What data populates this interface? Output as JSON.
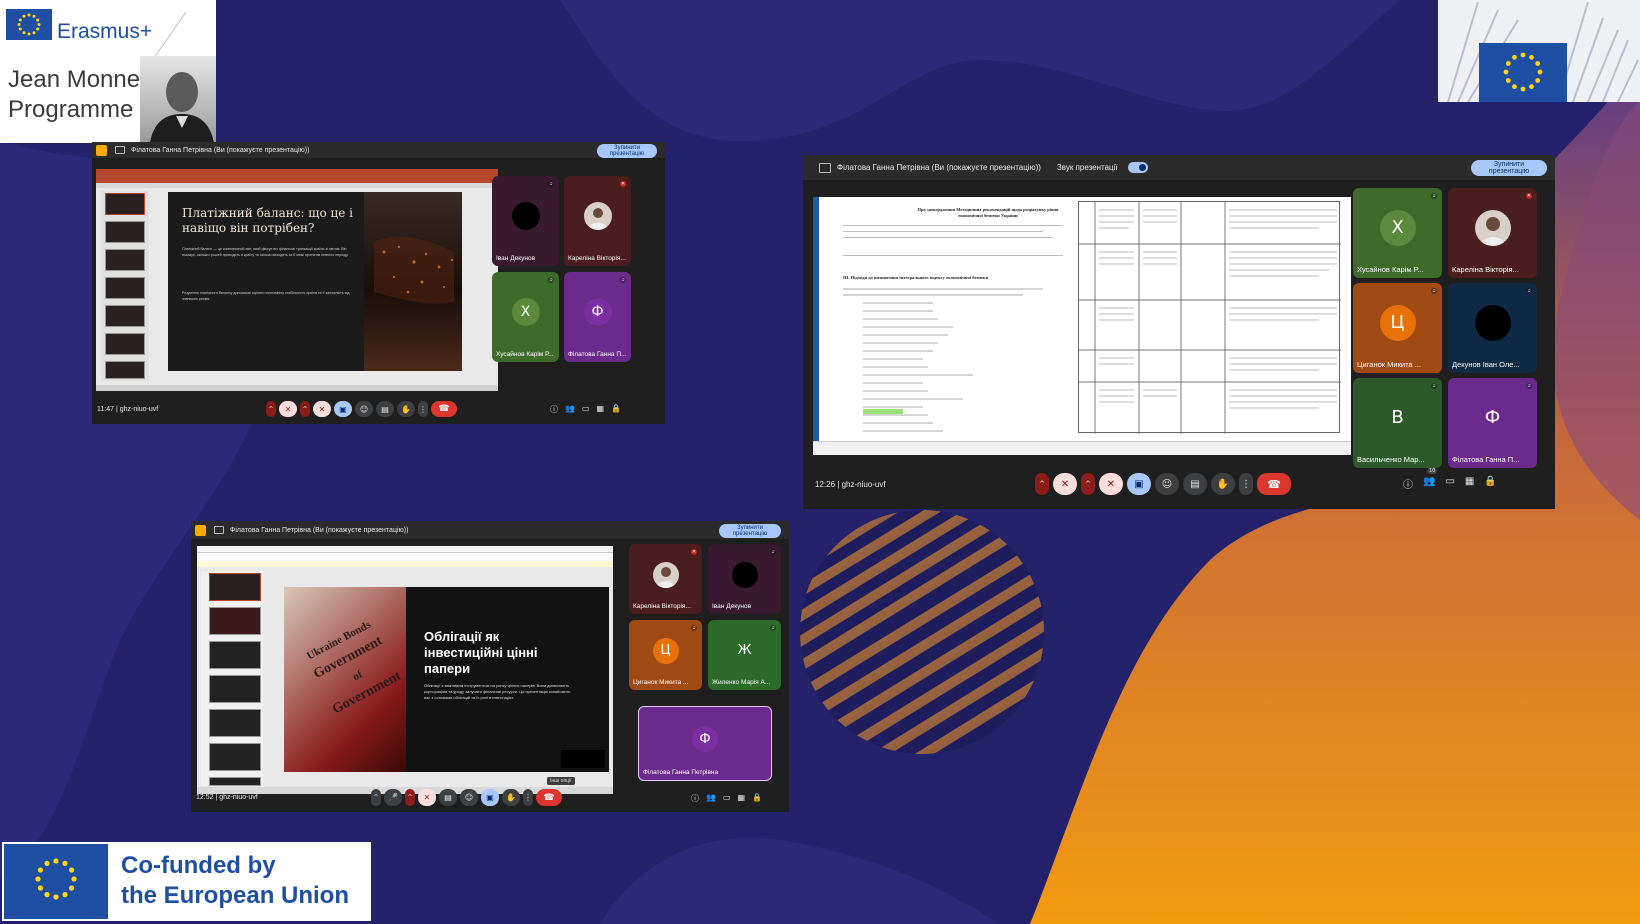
{
  "logos": {
    "erasmus": "Erasmus+",
    "jean_monnet": [
      "Jean Monnet",
      "Programme"
    ],
    "cofund": [
      "Co-funded by",
      "the European Union"
    ]
  },
  "screens": [
    {
      "presenter_label": "Філатова Ганна Петрівна (Ви (покажуєте презентацію))",
      "stop_label": "Зупинити презентацію",
      "time": "11:47",
      "meeting_code": "ghz-niuo-uvf",
      "slide": {
        "title": "Платіжний баланс: що це і навіщо він потрібен?",
        "body": "Платіжний баланс — це комплексний звіт, який фіксує всі фінансові транзакції країни зі світом. Він показує, скільки грошей приходить в країну та скільки виходить за її межі протягом певного періоду.",
        "body2": "Розуміння платіжного балансу допомагає оцінити економічну стабільність країни та її залежність від зовнішніх ринків."
      },
      "participants": [
        {
          "name": "Іван Декунов",
          "initial": "",
          "color": "#3a1a30",
          "avatar": "black"
        },
        {
          "name": "Кареліна Вікторія...",
          "initial": "",
          "color": "#4a1e1e",
          "avatar": "photo"
        },
        {
          "name": "Хусайнов Карім Р...",
          "initial": "Х",
          "color": "#3e6b2a",
          "avatar": "#5b8a3c"
        },
        {
          "name": "Філатова Ганна П...",
          "initial": "Ф",
          "color": "#6b2a8c",
          "avatar": "#7b2fa3"
        }
      ]
    },
    {
      "presenter_label": "Філатова Ганна Петрівна (Ви (покажуєте презентацію))",
      "sound_label": "Звук презентації",
      "stop_label": "Зупинити презентацію",
      "time": "12:26",
      "meeting_code": "ghz-niuo-uvf",
      "doc": {
        "title": "Про затвердження Методичних рекомендацій щодо розрахунку рівня економічної безпеки України",
        "section": "ІІІ. Підходи до визначення інтегрального індексу економічної безпеки"
      },
      "participants": [
        {
          "name": "Хусайнов Карім Р...",
          "initial": "Х",
          "color": "#3e6b2a",
          "avatar": "#5b8a3c"
        },
        {
          "name": "Кареліна Вікторія...",
          "initial": "",
          "color": "#4a1e1e",
          "avatar": "photo"
        },
        {
          "name": "Циганок Микита ...",
          "initial": "Ц",
          "color": "#a04a14",
          "avatar": "#e8710a"
        },
        {
          "name": "Декунов Іван Оле...",
          "initial": "",
          "color": "#0e2a44",
          "avatar": "black"
        },
        {
          "name": "Васильченко Мар...",
          "initial": "В",
          "color": "#2d5a2a",
          "avatar": "#2d5a2a"
        },
        {
          "name": "Філатова Ганна П...",
          "initial": "Ф",
          "color": "#6b2a8c",
          "avatar": "#6b2a8c"
        }
      ],
      "participant_count": "10"
    },
    {
      "presenter_label": "Філатова Ганна Петрівна (Ви (покажуєте презентацію))",
      "stop_label": "Зупинити презентацію",
      "time": "12:52",
      "meeting_code": "ghz-niuo-uvf",
      "slide": {
        "title": "Облігації як інвестиційні цінні папери",
        "body": "Облігації є важливим інструментом на ринку цінних паперів. Вони дозволяють корпораціям та уряду залучати фінансові ресурси. Ця презентація ознайомить вас з основами облігацій та їх ролі в інвестиціях.",
        "image_text": [
          "Ukraine Bonds",
          "Government",
          "of",
          "Government"
        ]
      },
      "tooltip": "Інші опції",
      "participants": [
        {
          "name": "Кареліна Вікторія...",
          "initial": "",
          "color": "#4a1e1e",
          "avatar": "photo"
        },
        {
          "name": "Іван Декунов",
          "initial": "",
          "color": "#3a1a30",
          "avatar": "black"
        },
        {
          "name": "Циганок Микита ...",
          "initial": "Ц",
          "color": "#a04a14",
          "avatar": "#e8710a"
        },
        {
          "name": "Жиленко Марія А...",
          "initial": "Ж",
          "color": "#2d6b2a",
          "avatar": "#2d6b2a"
        },
        {
          "name": "Філатова Ганна Петрівна",
          "initial": "Ф",
          "color": "#6b2a8c",
          "avatar": "#7b2fa3"
        }
      ]
    }
  ]
}
